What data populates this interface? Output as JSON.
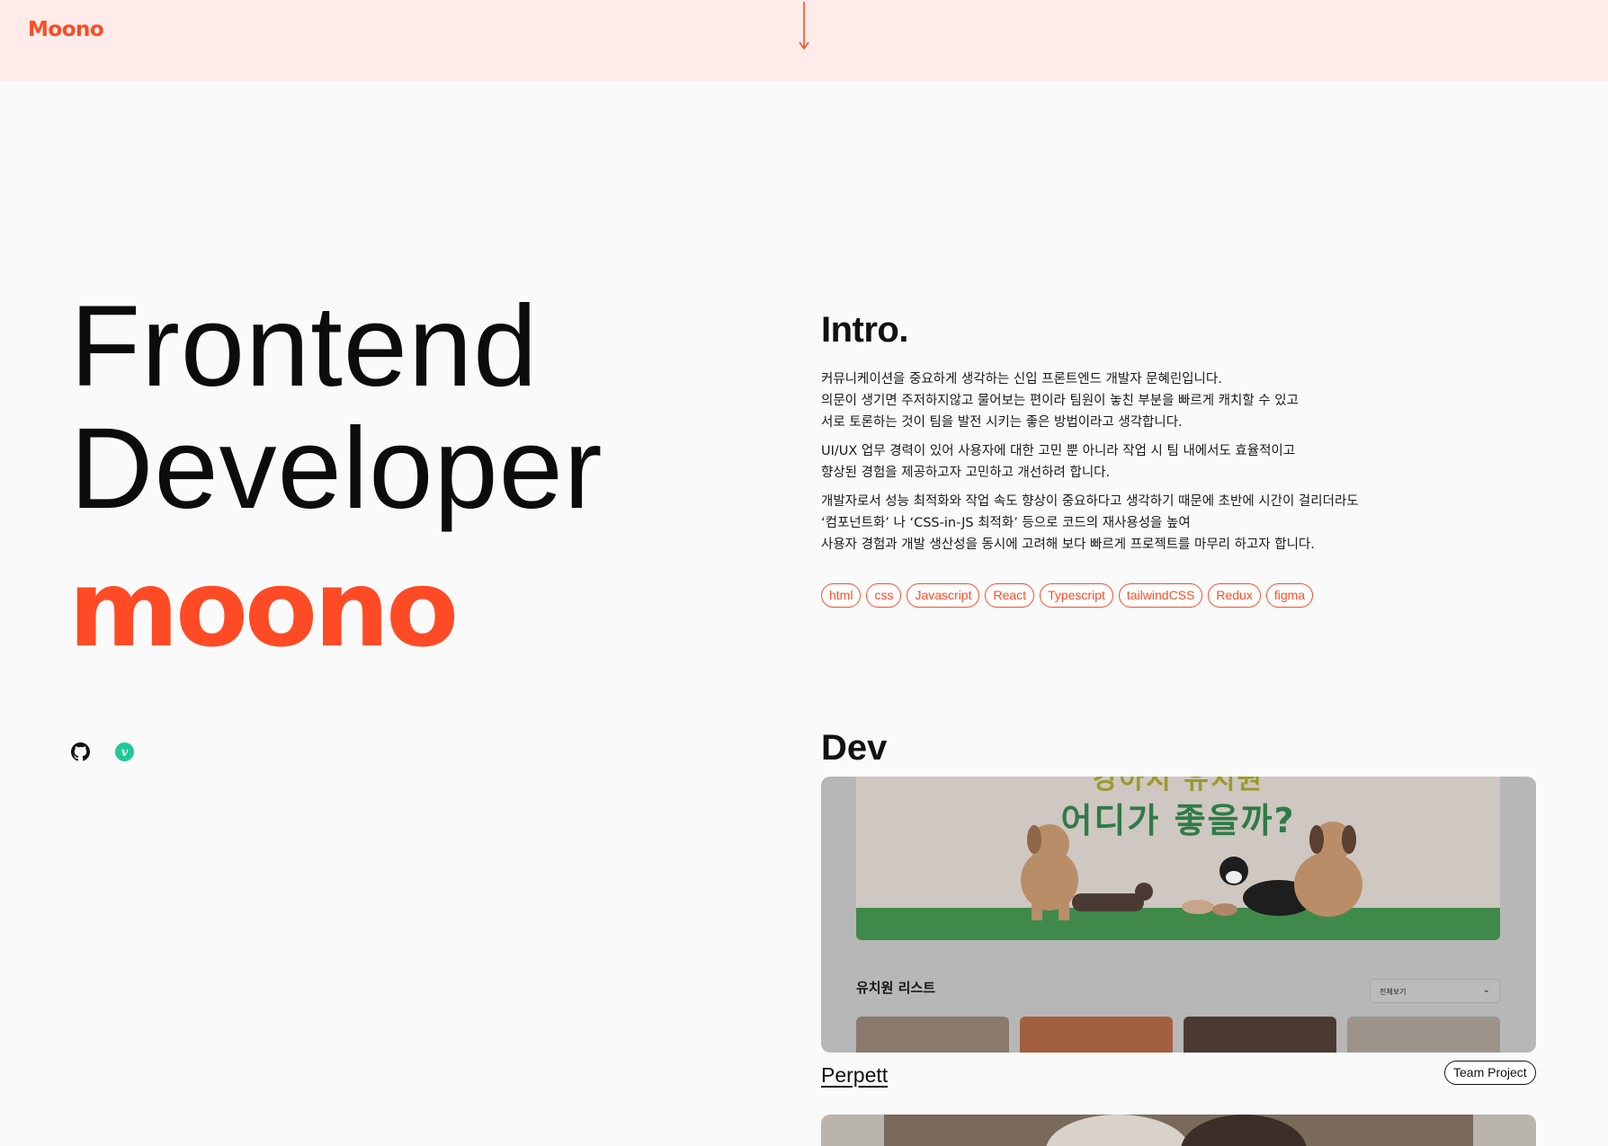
{
  "header": {
    "logo": "Moono"
  },
  "hero": {
    "title_line1": "Frontend",
    "title_line2": "Developer",
    "name": "moono"
  },
  "socials": [
    {
      "name": "github-icon"
    },
    {
      "name": "velog-icon",
      "letter": "v",
      "color": "#20c997"
    }
  ],
  "intro": {
    "heading": "Intro.",
    "paragraphs": [
      [
        "커뮤니케이션을 중요하게 생각하는 신입 프론트엔드 개발자 문혜린입니다.",
        "의문이 생기면 주저하지않고 물어보는 편이라 팀원이 놓친 부분을 빠르게 캐치할 수 있고",
        "서로 토론하는 것이 팀을 발전 시키는 좋은 방법이라고 생각합니다."
      ],
      [
        "UI/UX 업무 경력이 있어 사용자에 대한 고민 뿐 아니라 작업 시 팀 내에서도 효율적이고",
        "향상된 경험을 제공하고자 고민하고 개선하려 합니다."
      ],
      [
        "개발자로서 성능 최적화와 작업 속도 향상이 중요하다고 생각하기 때문에 초반에 시간이 걸리더라도",
        "‘컴포넌트화’ 나 ‘CSS-in-JS 최적화’ 등으로 코드의 재사용성을 높여",
        "사용자 경험과 개발 생산성을 동시에 고려해 보다 빠르게 프로젝트를 마무리 하고자 합니다."
      ]
    ],
    "tags": [
      "html",
      "css",
      "Javascript",
      "React",
      "Typescript",
      "tailwindCSS",
      "Redux",
      "figma"
    ]
  },
  "dev": {
    "heading": "Dev",
    "projects": [
      {
        "title": "Perpett",
        "badge": "Team Project",
        "preview": {
          "banner_title_top": "강아지 유치원",
          "banner_title": "어디가 좋을까?",
          "list_title": "유치원 리스트",
          "select_value": "전체보기"
        }
      }
    ]
  },
  "colors": {
    "accent": "#ff4b25",
    "header_bg": "#ffecea",
    "page_bg": "#fafafa"
  }
}
